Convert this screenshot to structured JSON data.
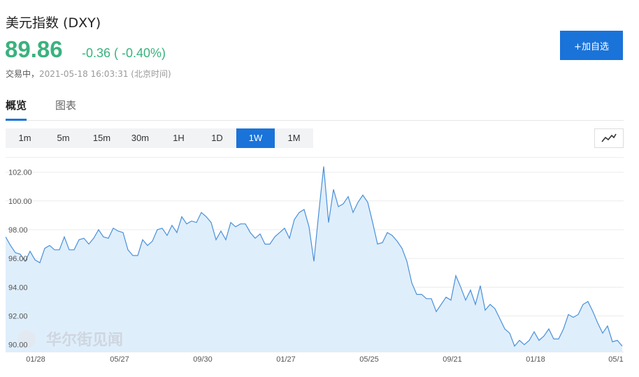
{
  "header": {
    "title": "美元指数 (DXY)",
    "price": "89.86",
    "change": "-0.36 ( -0.40%)",
    "status": "交易中，",
    "timestamp": "2021-05-18 16:03:31 (北京时间)",
    "add_button": "+加自选",
    "price_color": "#3ab27e"
  },
  "tabs": [
    {
      "label": "概览",
      "active": true
    },
    {
      "label": "图表",
      "active": false
    }
  ],
  "ranges": [
    {
      "label": "1m",
      "active": false
    },
    {
      "label": "5m",
      "active": false
    },
    {
      "label": "15m",
      "active": false
    },
    {
      "label": "30m",
      "active": false
    },
    {
      "label": "1H",
      "active": false
    },
    {
      "label": "1D",
      "active": false
    },
    {
      "label": "1W",
      "active": true
    },
    {
      "label": "1M",
      "active": false
    }
  ],
  "chart_type_icon": "line-chart-icon",
  "watermark": "华尔街见闻",
  "chart_data": {
    "type": "area",
    "ylim": [
      89.5,
      103.0
    ],
    "yticks": [
      "102.00",
      "100.00",
      "98.00",
      "96.00",
      "94.00",
      "92.00",
      "90.00"
    ],
    "ytick_values": [
      102,
      100,
      98,
      96,
      94,
      92,
      90
    ],
    "xticks": [
      "01/28",
      "05/27",
      "09/30",
      "01/27",
      "05/25",
      "09/21",
      "01/18",
      "05/1"
    ],
    "xtick_positions": [
      0,
      0,
      0,
      0,
      0,
      0,
      0,
      0
    ],
    "line_color": "#4a90d9",
    "fill_color": "#dfeefb",
    "values": [
      97.5,
      96.9,
      96.4,
      96.3,
      95.8,
      96.5,
      95.9,
      95.7,
      96.7,
      96.9,
      96.6,
      96.6,
      97.5,
      96.6,
      96.6,
      97.3,
      97.4,
      97.0,
      97.4,
      98.0,
      97.5,
      97.4,
      98.1,
      97.9,
      97.8,
      96.6,
      96.2,
      96.2,
      97.3,
      96.9,
      97.2,
      98.0,
      98.1,
      97.6,
      98.3,
      97.8,
      98.9,
      98.4,
      98.6,
      98.5,
      99.2,
      98.9,
      98.5,
      97.3,
      97.9,
      97.3,
      98.5,
      98.2,
      98.4,
      98.4,
      97.8,
      97.4,
      97.7,
      97.0,
      97.0,
      97.5,
      97.8,
      98.1,
      97.4,
      98.7,
      99.2,
      99.4,
      98.2,
      95.8,
      99.2,
      102.4,
      98.5,
      100.8,
      99.6,
      99.8,
      100.3,
      99.2,
      99.9,
      100.4,
      99.9,
      98.5,
      97.0,
      97.1,
      97.8,
      97.6,
      97.2,
      96.7,
      95.8,
      94.3,
      93.5,
      93.5,
      93.2,
      93.2,
      92.3,
      92.8,
      93.3,
      93.1,
      94.8,
      94.0,
      93.1,
      93.8,
      92.8,
      94.1,
      92.4,
      92.8,
      92.5,
      91.8,
      91.1,
      90.8,
      89.9,
      90.3,
      90.0,
      90.3,
      90.9,
      90.3,
      90.6,
      91.1,
      90.4,
      90.4,
      91.1,
      92.1,
      91.9,
      92.1,
      92.8,
      93.0,
      92.3,
      91.5,
      90.8,
      91.3,
      90.2,
      90.3,
      89.9
    ]
  }
}
